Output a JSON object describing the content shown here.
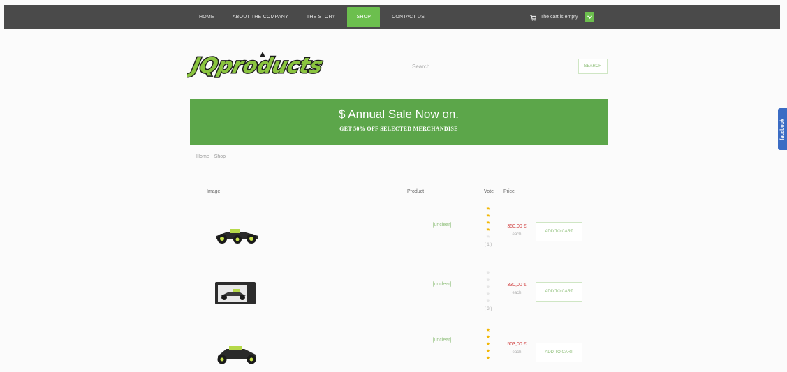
{
  "nav": {
    "items": [
      "HOME",
      "ABOUT THE COMPANY",
      "THE STORY",
      "SHOP",
      "CONTACT US"
    ],
    "active": "SHOP"
  },
  "cart": {
    "text": "The cart is empty"
  },
  "logo": {
    "icon": "jq-products-logo"
  },
  "search": {
    "placeholder": "Search",
    "button_label": "SEARCH"
  },
  "banner": {
    "title": "$ Annual Sale Now on.",
    "subtitle": "GET 50% OFF SELECTED MERCHANDISE"
  },
  "breadcrumb": [
    "Home",
    "Shop"
  ],
  "table": {
    "headers": {
      "image": "Image",
      "product": "Product",
      "vote": "Vote",
      "price": "Price"
    },
    "rows": [
      {
        "image_icon": "rc-buggy-1-icon",
        "name": "[unclear]",
        "price": "350,00 €",
        "unit": "each",
        "votes": "( 1 )",
        "stars": 4,
        "add_label": "ADD TO CART"
      },
      {
        "image_icon": "rc-buggy-boxed-icon",
        "name": "[unclear]",
        "price": "330,00 €",
        "unit": "each",
        "votes": "( 3 )",
        "stars": 0,
        "add_label": "ADD TO CART"
      },
      {
        "image_icon": "rc-buggy-3-icon",
        "name": "[unclear]",
        "price": "503,00 €",
        "unit": "each",
        "votes": "",
        "stars": 5,
        "add_label": "ADD TO CART"
      }
    ]
  },
  "social": {
    "facebook": "facebook"
  },
  "colors": {
    "accent": "#6cbf4e",
    "banner": "#5ca64a",
    "topbar": "#4a4a4a",
    "price": "#d04040",
    "link": "#8fbf7a",
    "star": "#f2b705",
    "facebook": "#3b6cc4"
  }
}
